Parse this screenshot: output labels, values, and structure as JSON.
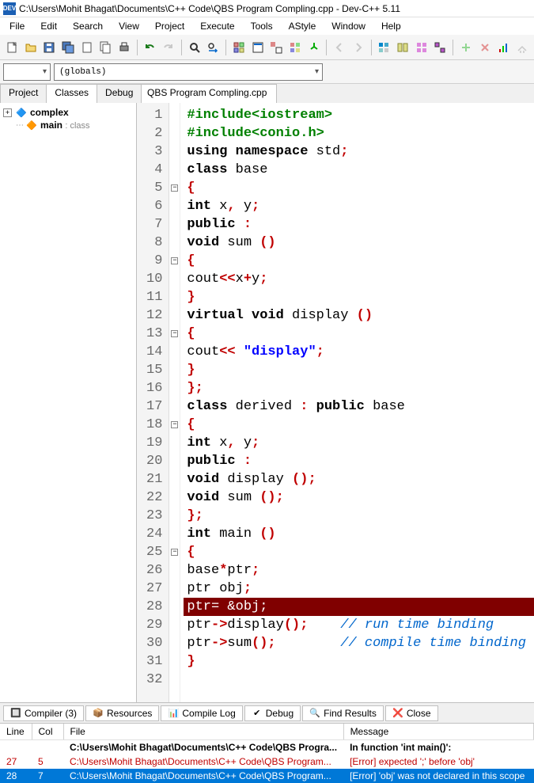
{
  "titlebar": {
    "icon_text": "DEV",
    "title": "C:\\Users\\Mohit Bhagat\\Documents\\C++ Code\\QBS Program Compling.cpp - Dev-C++ 5.11"
  },
  "menubar": [
    "File",
    "Edit",
    "Search",
    "View",
    "Project",
    "Execute",
    "Tools",
    "AStyle",
    "Window",
    "Help"
  ],
  "toolbar2": {
    "combo1": "",
    "combo2": "(globals)"
  },
  "left_tabs": [
    "Project",
    "Classes",
    "Debug"
  ],
  "left_active": 1,
  "tree": {
    "root": "complex",
    "child": "main",
    "child_type": ": class"
  },
  "editor_tab": "QBS Program Compling.cpp",
  "code": {
    "lines": [
      {
        "n": 1,
        "fold": "",
        "html": "<span class='kg'>#include</span><span class='kg'>&lt;iostream&gt;</span>"
      },
      {
        "n": 2,
        "fold": "",
        "html": "<span class='kg'>#include</span><span class='kg'>&lt;conio.h&gt;</span>"
      },
      {
        "n": 3,
        "fold": "",
        "html": "<span class='kb'>using</span> <span class='kb'>namespace</span> std<span class='sy'>;</span>"
      },
      {
        "n": 4,
        "fold": "",
        "html": "<span class='kb'>class</span> base"
      },
      {
        "n": 5,
        "fold": "-",
        "html": "<span class='sy'>{</span>"
      },
      {
        "n": 6,
        "fold": "",
        "html": "<span class='kb'>int</span> x<span class='sy'>,</span> y<span class='sy'>;</span>"
      },
      {
        "n": 7,
        "fold": "",
        "html": "<span class='kb'>public</span> <span class='sy'>:</span>"
      },
      {
        "n": 8,
        "fold": "",
        "html": "<span class='kb'>void</span> sum <span class='sy'>()</span>"
      },
      {
        "n": 9,
        "fold": "-",
        "html": "<span class='sy'>{</span>"
      },
      {
        "n": 10,
        "fold": "",
        "html": "cout<span class='sy'>&lt;&lt;</span>x<span class='sy'>+</span>y<span class='sy'>;</span>"
      },
      {
        "n": 11,
        "fold": "",
        "html": "<span class='sy'>}</span>"
      },
      {
        "n": 12,
        "fold": "",
        "html": "<span class='kb'>virtual</span> <span class='kb'>void</span> display <span class='sy'>()</span>"
      },
      {
        "n": 13,
        "fold": "-",
        "html": "<span class='sy'>{</span>"
      },
      {
        "n": 14,
        "fold": "",
        "html": "cout<span class='sy'>&lt;&lt;</span> <span class='str'>\"display\"</span><span class='sy'>;</span>"
      },
      {
        "n": 15,
        "fold": "",
        "html": "<span class='sy'>}</span>"
      },
      {
        "n": 16,
        "fold": "",
        "html": "<span class='sy'>};</span>"
      },
      {
        "n": 17,
        "fold": "",
        "html": "<span class='kb'>class</span> derived <span class='sy'>:</span> <span class='kb'>public</span> base"
      },
      {
        "n": 18,
        "fold": "-",
        "html": "<span class='sy'>{</span>"
      },
      {
        "n": 19,
        "fold": "",
        "html": "<span class='kb'>int</span> x<span class='sy'>,</span> y<span class='sy'>;</span>"
      },
      {
        "n": 20,
        "fold": "",
        "html": "<span class='kb'>public</span> <span class='sy'>:</span>"
      },
      {
        "n": 21,
        "fold": "",
        "html": "<span class='kb'>void</span> display <span class='sy'>();</span>"
      },
      {
        "n": 22,
        "fold": "",
        "html": "<span class='kb'>void</span> sum <span class='sy'>();</span>"
      },
      {
        "n": 23,
        "fold": "",
        "html": "<span class='sy'>};</span>"
      },
      {
        "n": 24,
        "fold": "",
        "html": "<span class='kb'>int</span> main <span class='sy'>()</span>"
      },
      {
        "n": 25,
        "fold": "-",
        "html": "<span class='sy'>{</span>"
      },
      {
        "n": 26,
        "fold": "",
        "html": "base<span class='sy'>*</span>ptr<span class='sy'>;</span>"
      },
      {
        "n": 27,
        "fold": "",
        "html": "ptr obj<span class='sy'>;</span>"
      },
      {
        "n": 28,
        "fold": "",
        "err": true,
        "html": "ptr= &amp;obj;"
      },
      {
        "n": 29,
        "fold": "",
        "html": "ptr<span class='sy'>-&gt;</span>display<span class='sy'>();</span>    <span class='cm'>// run time binding</span>"
      },
      {
        "n": 30,
        "fold": "",
        "html": "ptr<span class='sy'>-&gt;</span>sum<span class='sy'>();</span>        <span class='cm'>// compile time binding</span>"
      },
      {
        "n": 31,
        "fold": "",
        "html": "<span class='sy'>}</span>"
      },
      {
        "n": 32,
        "fold": "",
        "html": ""
      }
    ]
  },
  "bottom_tabs": [
    {
      "label": "Compiler (3)"
    },
    {
      "label": "Resources"
    },
    {
      "label": "Compile Log"
    },
    {
      "label": "Debug"
    },
    {
      "label": "Find Results"
    },
    {
      "label": "Close"
    }
  ],
  "compiler": {
    "headers": [
      "Line",
      "Col",
      "File",
      "Message"
    ],
    "rows": [
      {
        "line": "",
        "col": "",
        "file": "C:\\Users\\Mohit Bhagat\\Documents\\C++ Code\\QBS Progra...",
        "msg": "In function 'int main()':",
        "cls": "bold"
      },
      {
        "line": "27",
        "col": "5",
        "file": "C:\\Users\\Mohit Bhagat\\Documents\\C++ Code\\QBS Program...",
        "msg": "[Error] expected ';' before 'obj'",
        "cls": "red"
      },
      {
        "line": "28",
        "col": "7",
        "file": "C:\\Users\\Mohit Bhagat\\Documents\\C++ Code\\QBS Program...",
        "msg": "[Error] 'obj' was not declared in this scope",
        "cls": "selblue"
      }
    ]
  }
}
